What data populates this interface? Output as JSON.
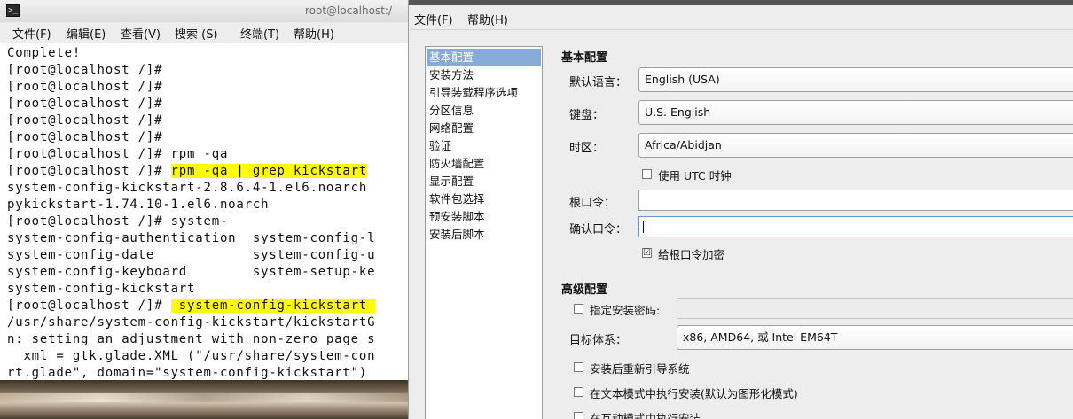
{
  "terminal": {
    "title": "root@localhost:/",
    "menu": [
      "文件(F)",
      "编辑(E)",
      "查看(V)",
      "搜索 (S)",
      "终端(T)",
      "帮助(H)"
    ],
    "lines": [
      "Complete!",
      "[root@localhost /]#",
      "[root@localhost /]#",
      "[root@localhost /]#",
      "[root@localhost /]#",
      "[root@localhost /]#",
      "[root@localhost /]# rpm -qa",
      "[root@localhost /]# ",
      "system-config-kickstart-2.8.6.4-1.el6.noarch",
      "pykickstart-1.74.10-1.el6.noarch",
      "[root@localhost /]# system-",
      "system-config-authentication  system-config-l",
      "system-config-date            system-config-u",
      "system-config-keyboard        system-setup-ke",
      "system-config-kickstart",
      "[root@localhost /]# ",
      "/usr/share/system-config-kickstart/kickstartG",
      "n: setting an adjustment with non-zero page s",
      "  xml = gtk.glade.XML (\"/usr/share/system-con",
      "rt.glade\", domain=\"system-config-kickstart\")"
    ],
    "hl1": "rpm -qa | grep kickstart",
    "hl2": " system-config-kickstart "
  },
  "kickstart": {
    "menu": [
      "文件(F)",
      "帮助(H)"
    ],
    "sidebar": [
      "基本配置",
      "安装方法",
      "引导装载程序选项",
      "分区信息",
      "网络配置",
      "验证",
      "防火墙配置",
      "显示配置",
      "软件包选择",
      "预安装脚本",
      "安装后脚本"
    ],
    "basic": {
      "title": "基本配置",
      "lang_label": "默认语言：",
      "lang_value": "English (USA)",
      "kbd_label": "键盘：",
      "kbd_value": "U.S. English",
      "tz_label": "时区：",
      "tz_value": "Africa/Abidjan",
      "utc_label": "使用 UTC 时钟",
      "rootpw_label": "根口令：",
      "confirm_label": "确认口令：",
      "encrypt_label": "给根口令加密"
    },
    "advanced": {
      "title": "高级配置",
      "install_key_label": "指定安装密码:",
      "arch_label": "目标体系：",
      "arch_value": "x86, AMD64, 或 Intel EM64T",
      "reboot_label": "安装后重新引导系统",
      "text_mode_label": "在文本模式中执行安装(默认为图形化模式)",
      "interactive_label": "在互动模式中执行安装"
    },
    "encrypt_checked": "☑"
  }
}
